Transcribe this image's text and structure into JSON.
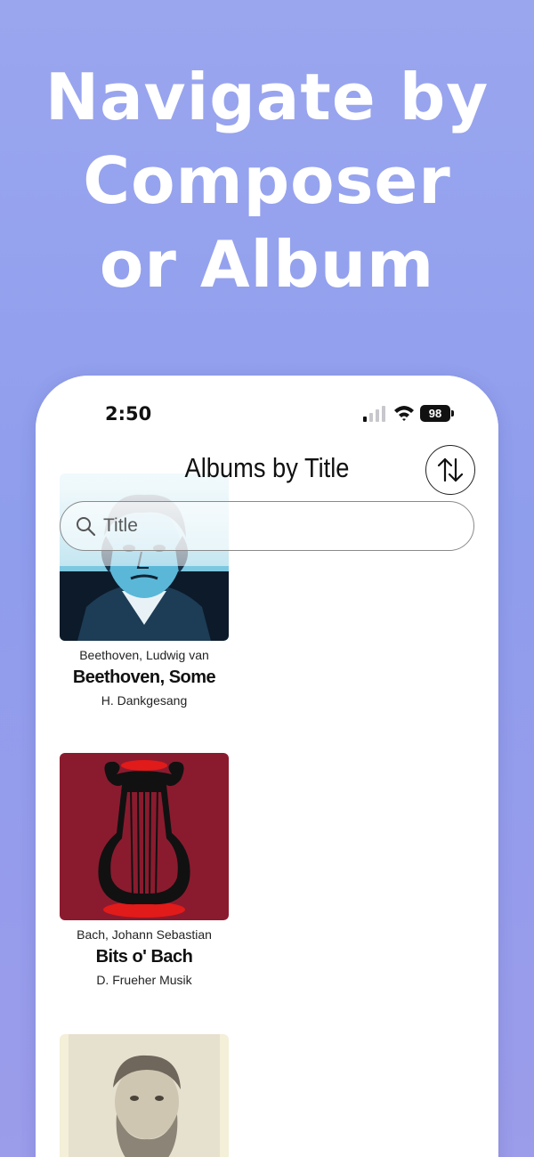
{
  "promo": {
    "headline_lines": [
      "Navigate by",
      "Composer",
      "or Album"
    ]
  },
  "status_bar": {
    "time": "2:50",
    "battery": "98"
  },
  "nav": {
    "title": "Albums by Title",
    "sort_icon": "sort-arrows-icon"
  },
  "search": {
    "placeholder": "Title",
    "value": ""
  },
  "albums": [
    {
      "composer": "Beethoven, Ludwig van",
      "title": "Beethoven, Some",
      "publisher": "H. Dankgesang",
      "cover": "beethoven-portrait-image"
    },
    {
      "composer": "Bach, Johann Sebastian",
      "title": "Bits o' Bach",
      "publisher": "D. Frueher Musik",
      "cover": "lyre-image"
    },
    {
      "composer": "",
      "title": "",
      "publisher": "",
      "cover": "brahms-portrait-image"
    }
  ],
  "colors": {
    "background": "#9aa6ee",
    "lyre_cover_bg": "#8a1b2e",
    "beethoven_cover_tint": "#5ab7d8"
  }
}
